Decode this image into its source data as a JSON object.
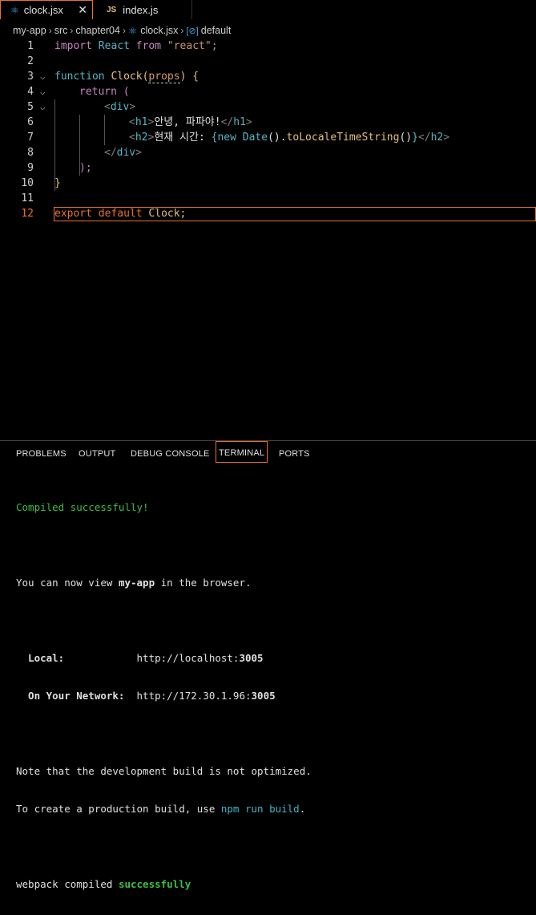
{
  "tabs": [
    {
      "label": "clock.jsx",
      "icon": "react-icon",
      "close": "✕"
    },
    {
      "label": "index.js",
      "icon": "JS"
    }
  ],
  "breadcrumb": {
    "items": [
      "my-app",
      "src",
      "chapter04",
      "clock.jsx",
      "default"
    ]
  },
  "editor": {
    "line_numbers": [
      "1",
      "2",
      "3",
      "4",
      "5",
      "6",
      "7",
      "8",
      "9",
      "10",
      "11",
      "12"
    ],
    "l1": {
      "a": "import",
      "b": " React ",
      "c": "from",
      "d": " \"react\";"
    },
    "l3": {
      "a": "function",
      "b": " Clock",
      "c": "(",
      "d": "props",
      "e": ")",
      "f": " {"
    },
    "l4": {
      "a": "return",
      "b": " ("
    },
    "l5": {
      "a": "<",
      "b": "div",
      "c": ">"
    },
    "l6": {
      "a": "<",
      "b": "h1",
      "c": ">",
      "d": "안녕, 파파야!",
      "e": "</",
      "f": "h1",
      "g": ">"
    },
    "l7": {
      "a": "<",
      "b": "h2",
      "c": ">",
      "d": "현재 시간: ",
      "e": "{",
      "f": "new",
      "g": " Date",
      "h": "().",
      "i": "toLocaleTimeString",
      "j": "()",
      "k": "}",
      "l": "</",
      "m": "h2",
      "n": ">"
    },
    "l8": {
      "a": "</",
      "b": "div",
      "c": ">"
    },
    "l9": {
      "a": ");"
    },
    "l10": {
      "a": "}"
    },
    "l12": {
      "a": "export",
      "b": " default",
      "c": " Clock;"
    }
  },
  "panel": {
    "tabs": [
      "PROBLEMS",
      "OUTPUT",
      "DEBUG CONSOLE",
      "TERMINAL",
      "PORTS"
    ],
    "terminal": {
      "t1": "Compiled successfully!",
      "t2a": "You can now view ",
      "t2b": "my-app",
      "t2c": " in the browser.",
      "t3a": "  Local:",
      "t3b": "            http://localhost:",
      "t3c": "3005",
      "t4a": "  On Your Network:",
      "t4b": "  http://172.30.1.96:",
      "t4c": "3005",
      "t5": "Note that the development build is not optimized.",
      "t6a": "To create a production build, use ",
      "t6b": "npm run build",
      ".": ".",
      "t6c": ".",
      "t7a": "webpack compiled ",
      "t7b": "successfully"
    }
  }
}
